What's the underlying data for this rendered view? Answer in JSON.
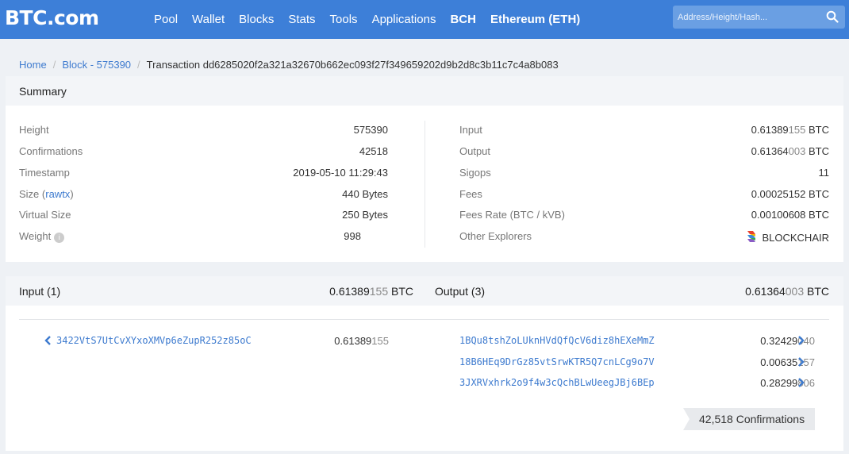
{
  "brand": {
    "logo": "BTC.com",
    "accent": "#3d7fd8",
    "link_color": "#3e7bcf"
  },
  "nav": {
    "items": [
      "Pool",
      "Wallet",
      "Blocks",
      "Stats",
      "Tools",
      "Applications",
      "BCH",
      "Ethereum (ETH)"
    ]
  },
  "search": {
    "placeholder": "Address/Height/Hash...",
    "icon": "search-icon"
  },
  "breadcrumb": {
    "home": "Home",
    "block": "Block - 575390",
    "current": "Transaction dd6285020f2a321a32670b662ec093f27f349659202d9b2d8c3b11c7c4a8b083"
  },
  "summary": {
    "title": "Summary",
    "left": [
      {
        "label": "Height",
        "value": "575390"
      },
      {
        "label": "Confirmations",
        "value": "42518"
      },
      {
        "label": "Timestamp",
        "value": "2019-05-10 11:29:43"
      },
      {
        "label": "Size",
        "label_link": "rawtx",
        "value": "440 Bytes"
      },
      {
        "label": "Virtual Size",
        "value": "250 Bytes"
      },
      {
        "label": "Weight",
        "value": "998"
      }
    ],
    "right": [
      {
        "label": "Input",
        "value_main": "0.61389",
        "value_dim": "155",
        "unit": "BTC"
      },
      {
        "label": "Output",
        "value_main": "0.61364",
        "value_dim": "003",
        "unit": "BTC"
      },
      {
        "label": "Sigops",
        "value": "11"
      },
      {
        "label": "Fees",
        "value": "0.00025152 BTC"
      },
      {
        "label": "Fees Rate (BTC / kVB)",
        "value": "0.00100608 BTC"
      },
      {
        "label": "Other Explorers",
        "value": "BLOCKCHAIR"
      }
    ]
  },
  "io": {
    "input_title": "Input (1)",
    "input_total_main": "0.61389",
    "input_total_dim": "155",
    "output_title": "Output (3)",
    "output_total_main": "0.61364",
    "output_total_dim": "003",
    "unit": "BTC",
    "inputs": [
      {
        "address": "3422VtS7UtCvXYxoXMVp6eZupR252z85oC",
        "amount_main": "0.61389",
        "amount_dim": "155"
      }
    ],
    "outputs": [
      {
        "address": "1BQu8tshZoLUknHVdQfQcV6diz8hEXeMmZ",
        "amount_main": "0.32429",
        "amount_dim": "040"
      },
      {
        "address": "18B6HEq9DrGz85vtSrwKTR5Q7cnLCg9o7V",
        "amount_main": "0.00635",
        "amount_dim": "157"
      },
      {
        "address": "3JXRVxhrk2o9f4w3cQchBLwUeegJBj6BEp",
        "amount_main": "0.28299",
        "amount_dim": "806"
      }
    ],
    "confirmations_badge": "42,518 Confirmations"
  }
}
